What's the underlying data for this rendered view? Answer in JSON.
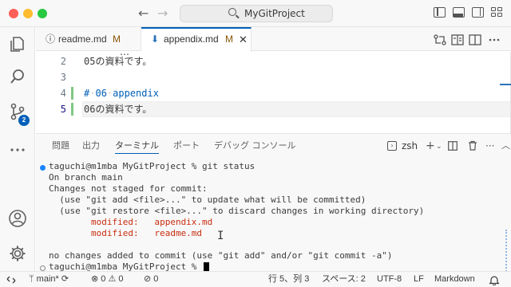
{
  "titlebar": {
    "search_title": "MyGitProject"
  },
  "tabs": [
    {
      "name": "readme.md",
      "status": "M",
      "icon": "info-icon"
    },
    {
      "name": "appendix.md",
      "status": "M",
      "icon": "markdown-download-icon",
      "close": "✕"
    }
  ],
  "activity": {
    "scm_badge": "2"
  },
  "editor": {
    "cut_line": "…",
    "lines": [
      {
        "num": "2",
        "text": "05の資料です。"
      },
      {
        "num": "3",
        "text": ""
      },
      {
        "num": "4",
        "text": ""
      },
      {
        "num": "5",
        "text": ""
      }
    ],
    "heading_hash": "#",
    "heading_dot1": "·",
    "heading_num": "06",
    "heading_dot2": "·",
    "heading_word": "appendix",
    "line5_text": "06の資料です。"
  },
  "panel": {
    "tabs": [
      "問題",
      "出力",
      "ターミナル",
      "ポート",
      "デバッグ コンソール"
    ],
    "active_tab": "ターミナル",
    "shell": "zsh",
    "terminal_lines": [
      {
        "text": "taguchi@m1mba MyGitProject % git status",
        "color": "normal",
        "dot": "filled"
      },
      {
        "text": "On branch main",
        "color": "normal"
      },
      {
        "text": "Changes not staged for commit:",
        "color": "normal"
      },
      {
        "text": "  (use \"git add <file>...\" to update what will be committed)",
        "color": "normal"
      },
      {
        "text": "  (use \"git restore <file>...\" to discard changes in working directory)",
        "color": "normal"
      },
      {
        "text": "        modified:   appendix.md",
        "color": "red"
      },
      {
        "text": "        modified:   readme.md",
        "color": "red"
      },
      {
        "text": "",
        "color": "normal"
      },
      {
        "text": "no changes added to commit (use \"git add\" and/or \"git commit -a\")",
        "color": "normal"
      },
      {
        "text": "taguchi@m1mba MyGitProject % ",
        "color": "normal",
        "dot": "empty",
        "cursor": true
      }
    ]
  },
  "statusbar": {
    "branch": "main*",
    "errors": "0",
    "warnings": "0",
    "ports": "0",
    "position": "行 5、列 3",
    "spaces": "スペース: 2",
    "encoding": "UTF-8",
    "eol": "LF",
    "language": "Markdown"
  }
}
